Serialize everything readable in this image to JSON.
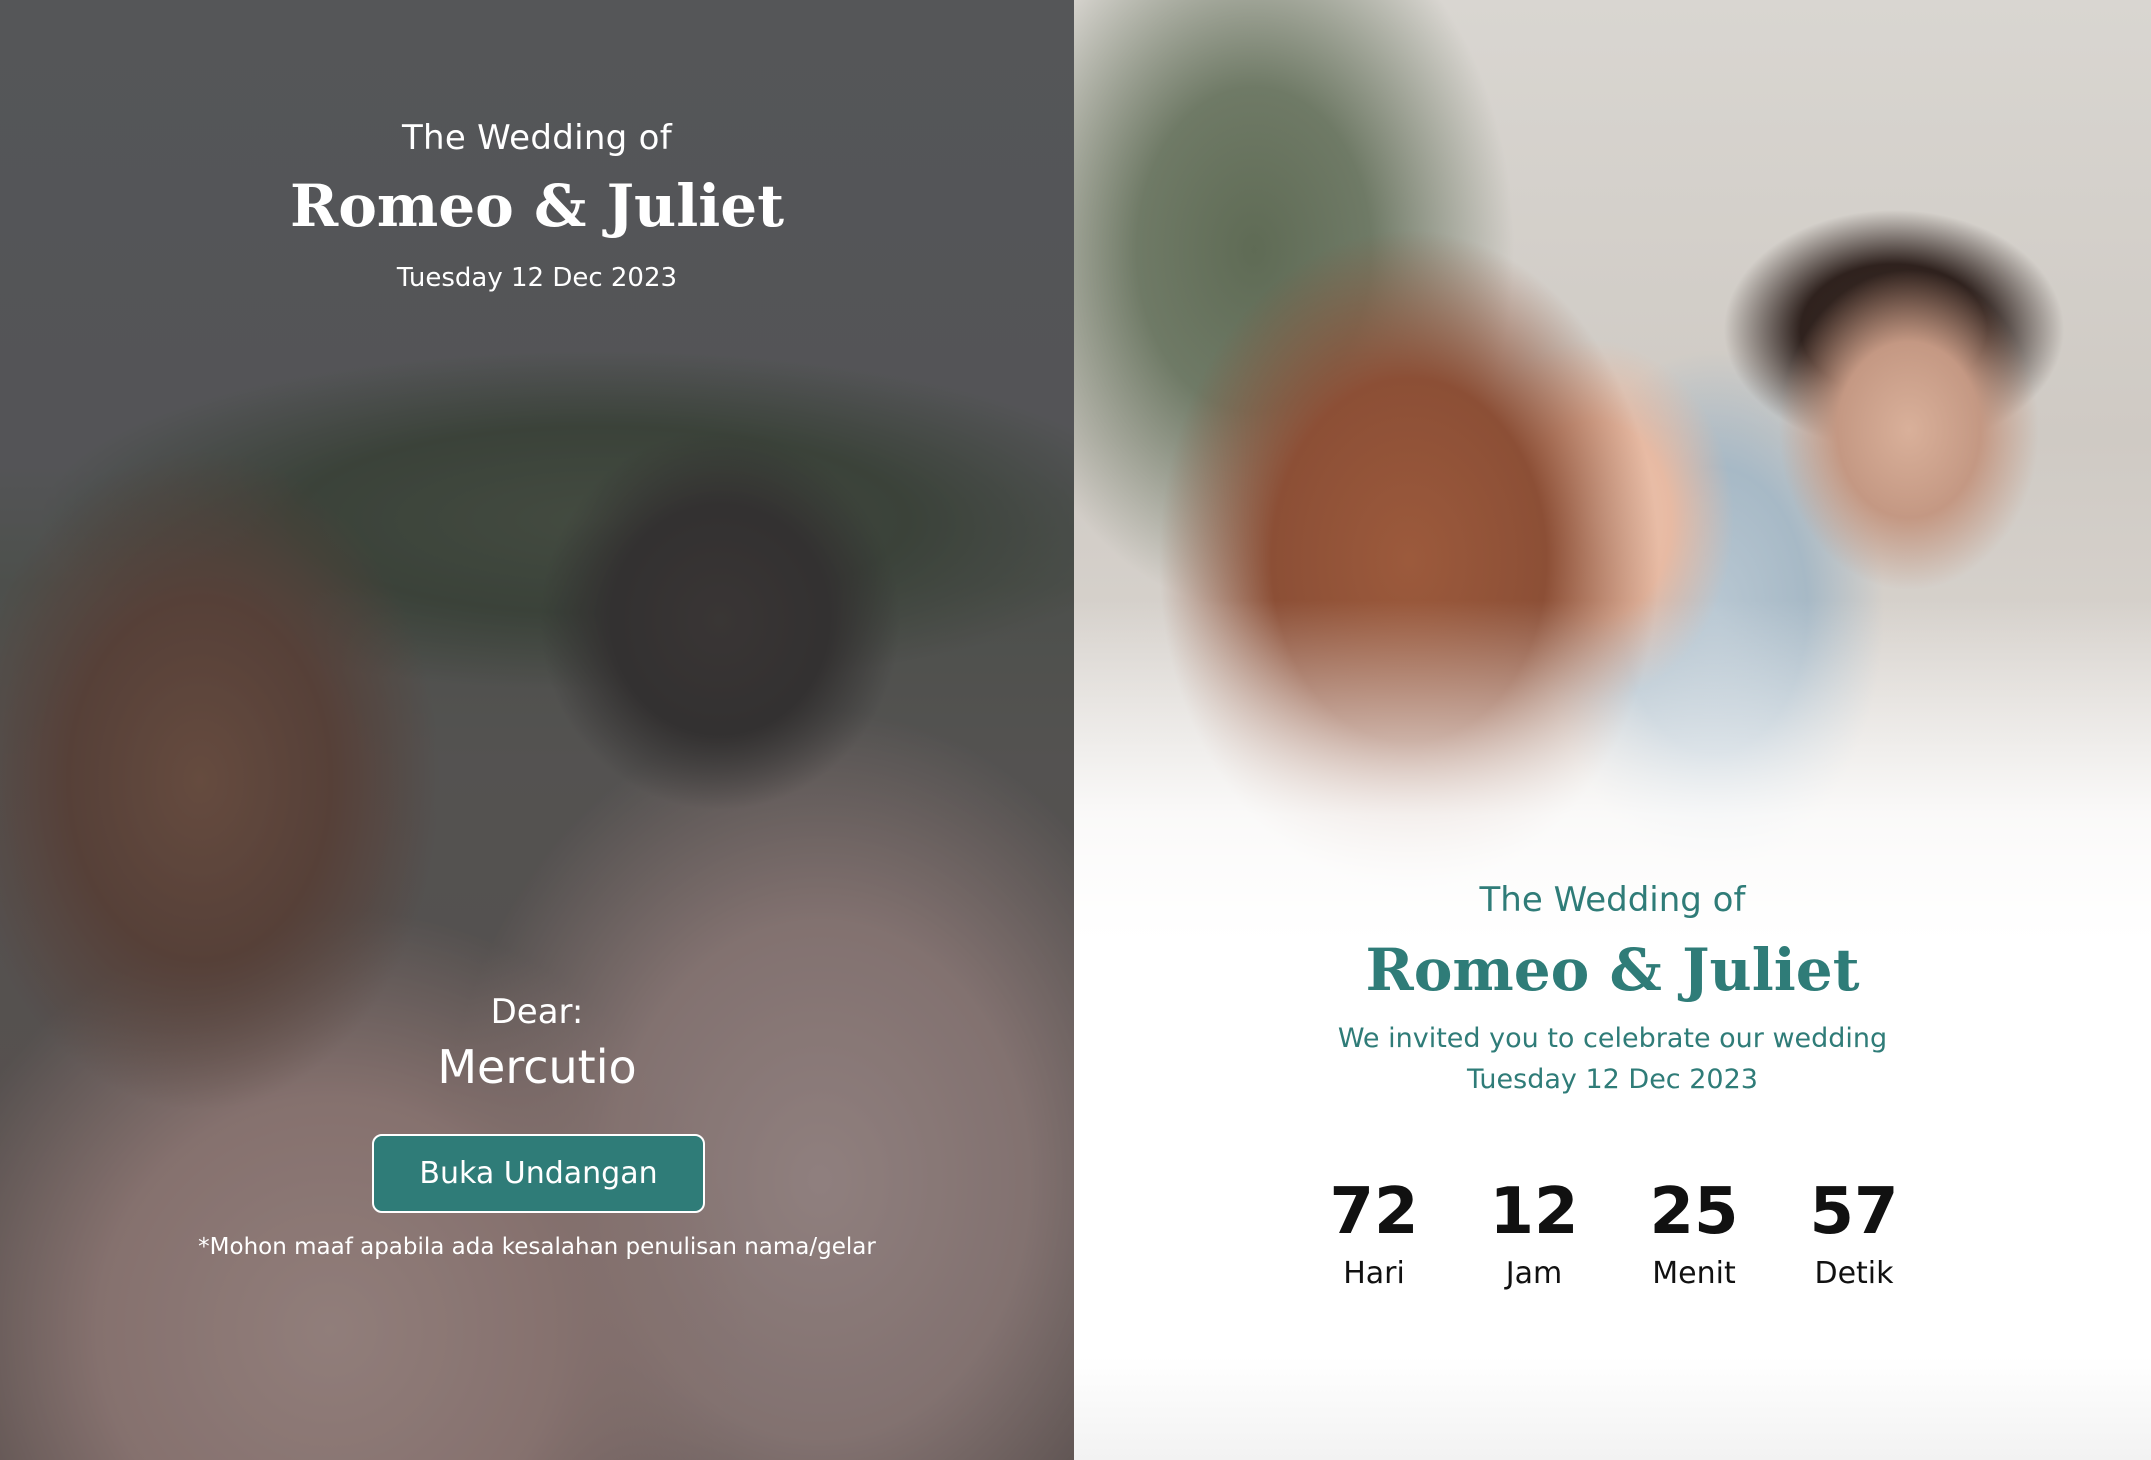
{
  "cover": {
    "kicker": "The Wedding of",
    "couple": "Romeo & Juliet",
    "date": "Tuesday 12 Dec 2023",
    "dear_label": "Dear:",
    "guest_name": "Mercutio",
    "open_button_label": "Buka Undangan",
    "note": "*Mohon maaf apabila ada kesalahan penulisan nama/gelar"
  },
  "hero": {
    "kicker": "The Wedding of",
    "couple": "Romeo & Juliet",
    "invite_text": "We invited you to celebrate our wedding",
    "date": "Tuesday 12 Dec 2023"
  },
  "countdown": [
    {
      "value": "72",
      "label": "Hari"
    },
    {
      "value": "12",
      "label": "Jam"
    },
    {
      "value": "25",
      "label": "Menit"
    },
    {
      "value": "57",
      "label": "Detik"
    }
  ],
  "colors": {
    "accent": "#2f7c78",
    "cover_overlay": "#3a3a3c",
    "countdown_text": "#111111"
  }
}
